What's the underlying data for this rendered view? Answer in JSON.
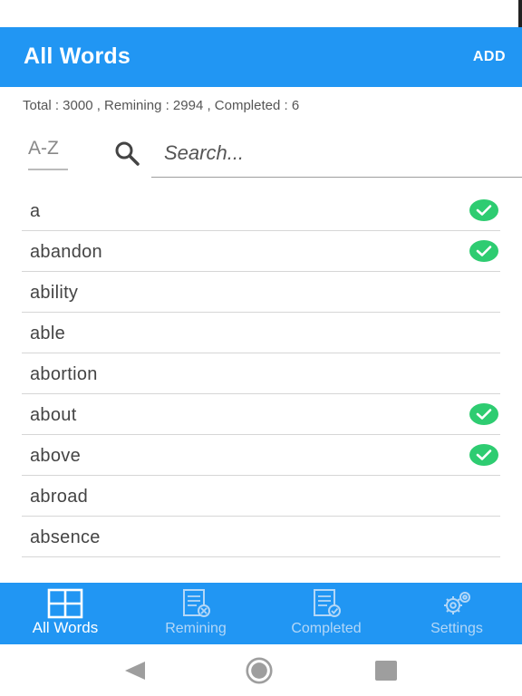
{
  "appbar": {
    "title": "All Words",
    "add_label": "ADD"
  },
  "stats": {
    "text": "Total : 3000 , Remining : 2994 , Completed : 6"
  },
  "controls": {
    "sort_label": "A-Z",
    "search_placeholder": "Search...",
    "search_value": ""
  },
  "words": [
    {
      "word": "a",
      "completed": true
    },
    {
      "word": "abandon",
      "completed": true
    },
    {
      "word": "ability",
      "completed": false
    },
    {
      "word": "able",
      "completed": false
    },
    {
      "word": "abortion",
      "completed": false
    },
    {
      "word": "about",
      "completed": true
    },
    {
      "word": "above",
      "completed": true
    },
    {
      "word": "abroad",
      "completed": false
    },
    {
      "word": "absence",
      "completed": false
    }
  ],
  "bottom_nav": [
    {
      "label": "All Words",
      "icon": "grid-icon",
      "active": true
    },
    {
      "label": "Remining",
      "icon": "document-remove-icon",
      "active": false
    },
    {
      "label": "Completed",
      "icon": "document-check-icon",
      "active": false
    },
    {
      "label": "Settings",
      "icon": "gear-icon",
      "active": false
    }
  ],
  "colors": {
    "primary": "#2196f3",
    "check": "#2ecc71",
    "nav_inactive": "#b3d7f7"
  }
}
